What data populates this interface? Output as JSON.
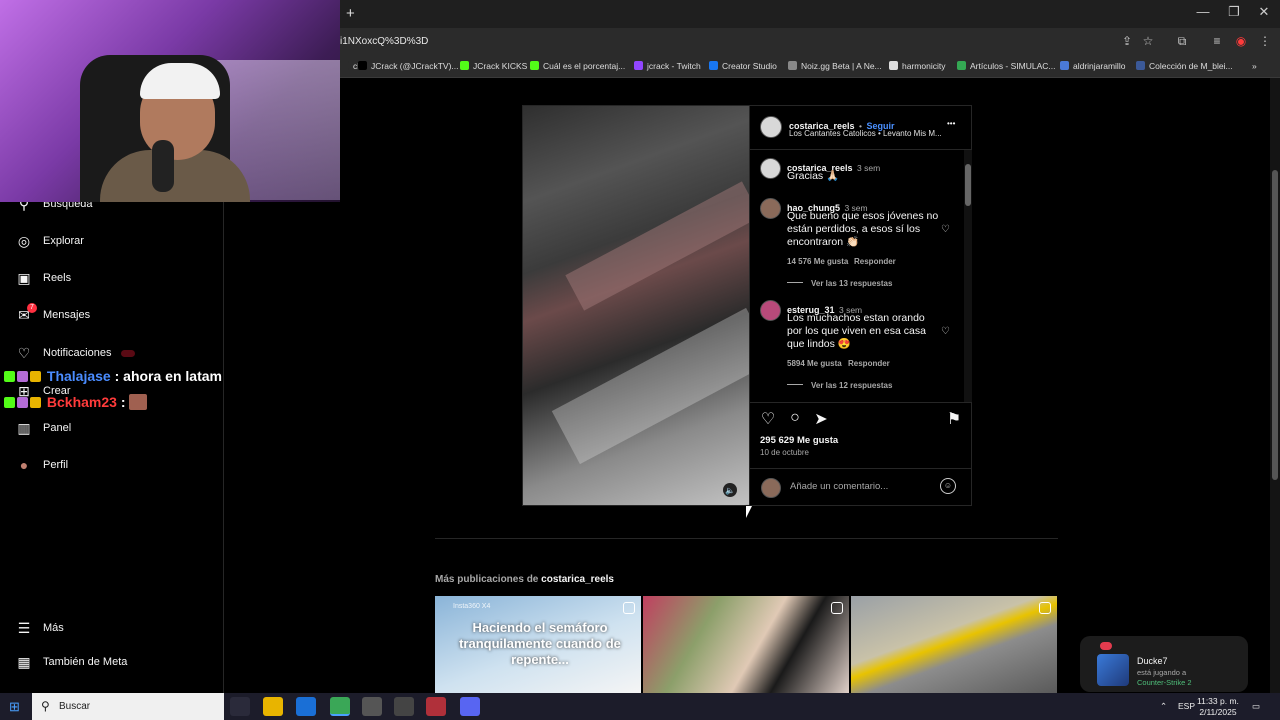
{
  "browser": {
    "new_tab": "+",
    "url": "i1NXoxcQ%3D%3D",
    "window_minimize": "—",
    "window_restore": "❐",
    "window_close": "✕",
    "bookmarks": [
      {
        "label": "ch",
        "color": "#2b2b2b"
      },
      {
        "label": "JCrack (@JCrackTV)...",
        "color": "#000000"
      },
      {
        "label": "JCrack KICKS",
        "color": "#53fc18"
      },
      {
        "label": "Cuál es el porcentaj...",
        "color": "#53fc18"
      },
      {
        "label": "jcrack - Twitch",
        "color": "#9146ff"
      },
      {
        "label": "Creator Studio",
        "color": "#1877f2"
      },
      {
        "label": "Noiz.gg Beta | A Ne...",
        "color": "#888888"
      },
      {
        "label": "harmonicity",
        "color": "#dddddd"
      },
      {
        "label": "Artículos - SIMULAC...",
        "color": "#34a853"
      },
      {
        "label": "aldrinjaramillo",
        "color": "#4a7ad9"
      },
      {
        "label": "Colección de M_blei...",
        "color": "#3b5998"
      }
    ]
  },
  "sidebar": {
    "items": [
      {
        "label": "Búsqueda",
        "icon": "search-icon",
        "glyph": "⚲"
      },
      {
        "label": "Explorar",
        "icon": "compass-icon",
        "glyph": "◎"
      },
      {
        "label": "Reels",
        "icon": "reels-icon",
        "glyph": "▣"
      },
      {
        "label": "Mensajes",
        "icon": "messenger-icon",
        "glyph": "✉",
        "badge": "7"
      },
      {
        "label": "Notificaciones",
        "icon": "heart-icon",
        "glyph": "♡"
      },
      {
        "label": "Crear",
        "icon": "plus-square-icon",
        "glyph": "⊞"
      },
      {
        "label": "Panel",
        "icon": "chart-icon",
        "glyph": "▥"
      },
      {
        "label": "Perfil",
        "icon": "avatar-icon",
        "glyph": "●"
      }
    ],
    "more": "Más",
    "meta": "También de Meta"
  },
  "chat": [
    {
      "user": "Thalajase",
      "message": ": ahora en latam",
      "color": "#4a8cff"
    },
    {
      "user": "Bckham23",
      "message": ":",
      "color": "#ff3b3b"
    }
  ],
  "post": {
    "author": "costarica_reels",
    "follow": "Seguir",
    "separator": "•",
    "audio": "Los Cantantes Catolicos • Levanto Mis M...",
    "more_options": "•••",
    "comments": [
      {
        "user": "costarica_reels",
        "time": "3 sem",
        "text": "Gracias 🙏🏻"
      },
      {
        "user": "hao_chung5",
        "time": "3 sem",
        "text": "Que bueno que esos jóvenes no están perdidos, a esos sí los encontraron 👏🏻",
        "likes": "14 576 Me gusta",
        "reply": "Responder",
        "view_replies": "Ver las 13 respuestas"
      },
      {
        "user": "esterug_31",
        "time": "3 sem",
        "text": "Los muchachos estan orando por los que viven en esa casa que lindos 😍",
        "likes": "5894 Me gusta",
        "reply": "Responder",
        "view_replies": "Ver las 12 respuestas"
      }
    ],
    "like_count": "295 629 Me gusta",
    "date": "10 de octubre",
    "comment_placeholder": "Añade un comentario...",
    "mute_glyph": "🔈"
  },
  "more_posts": {
    "prefix": "Más publicaciones de",
    "author": "costarica_reels",
    "thumb1_tag": "Insta360 X4",
    "thumb1_text": "Haciendo el semáforo tranquilamente cuando de repente..."
  },
  "toast": {
    "name": "Ducke7",
    "line1": "está jugando a",
    "line2": "Counter-Strike 2"
  },
  "taskbar": {
    "search": "Buscar",
    "lang": "ESP",
    "time": "11:33 p. m.",
    "date": "2/11/2025"
  }
}
